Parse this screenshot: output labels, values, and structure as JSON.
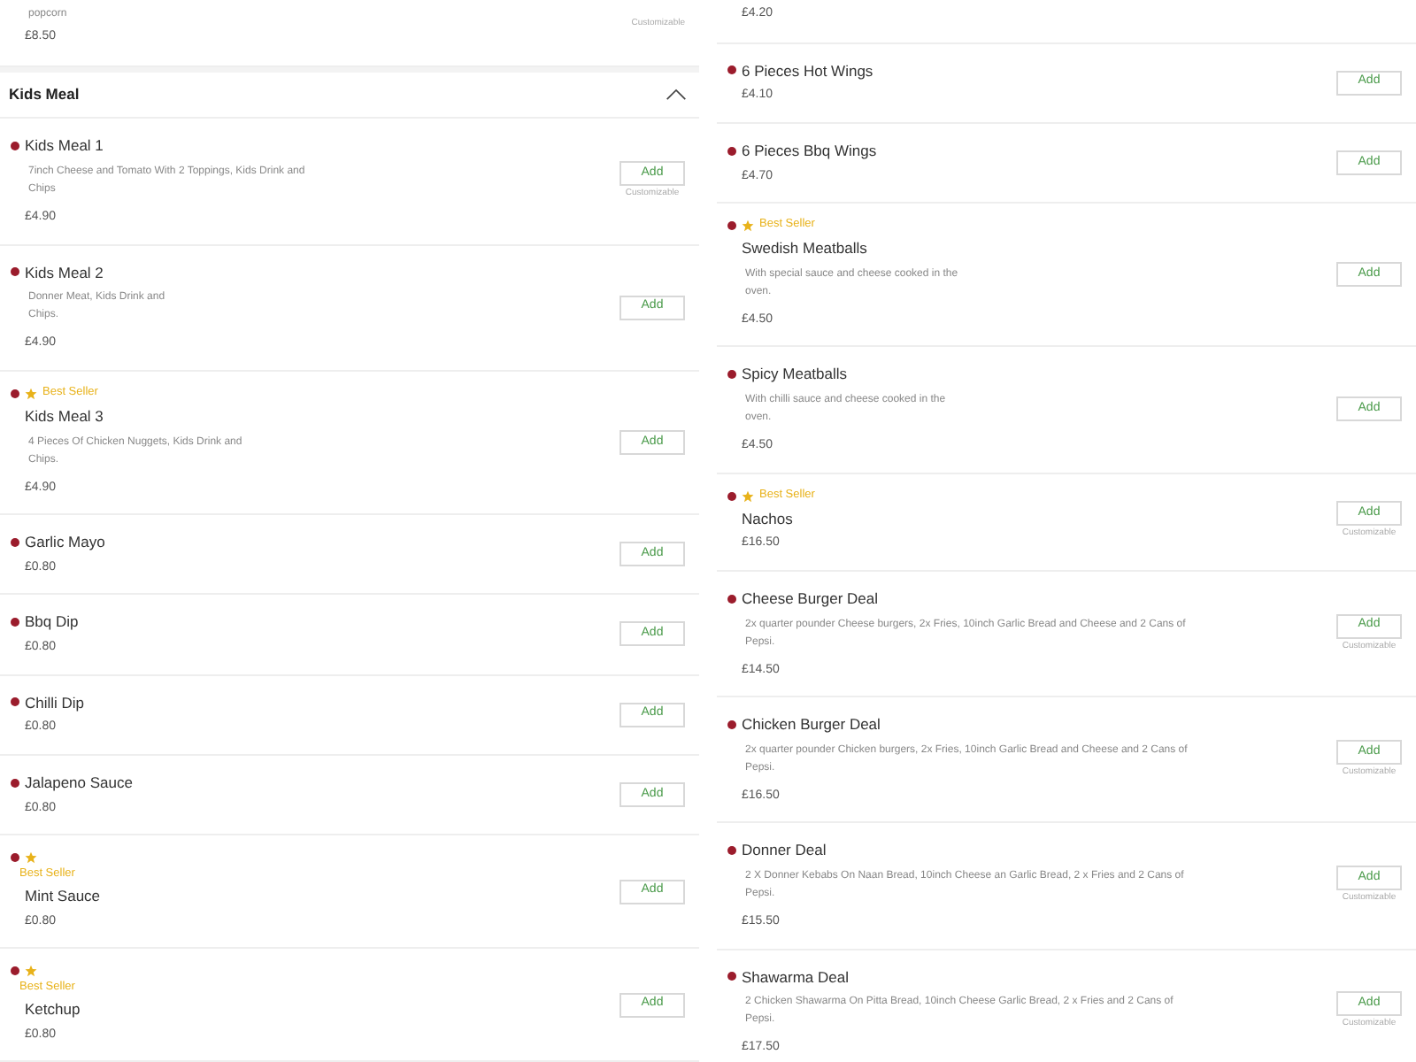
{
  "columns": [
    {
      "blocks": [
        {
          "kind": "item",
          "description_lines": [
            "popcorn"
          ],
          "price": "£8.50",
          "customizable_label": "Customizable"
        },
        {
          "kind": "header",
          "title": "Kids Meal",
          "expanded": true
        },
        {
          "kind": "item",
          "name": "Kids Meal 1",
          "description_lines": [
            "7inch Cheese and Tomato With 2 Toppings, Kids Drink and",
            "Chips"
          ],
          "price": "£4.90",
          "add_label": "Add",
          "customizable_label": "Customizable"
        },
        {
          "kind": "item",
          "name": "Kids Meal 2",
          "description_lines": [
            "Donner Meat, Kids Drink and",
            "Chips."
          ],
          "price": "£4.90",
          "add_label": "Add"
        },
        {
          "kind": "item",
          "name": "Kids Meal 3",
          "description_lines": [
            "4 Pieces Of Chicken Nuggets, Kids Drink and",
            "Chips."
          ],
          "price": "£4.90",
          "add_label": "Add",
          "best_seller": {
            "kind": "inline",
            "label": "Best Seller"
          }
        },
        {
          "kind": "item",
          "name": "Garlic Mayo",
          "price": "£0.80",
          "add_label": "Add"
        },
        {
          "kind": "item",
          "name": "Bbq Dip",
          "price": "£0.80",
          "add_label": "Add"
        },
        {
          "kind": "item",
          "name": "Chilli Dip",
          "price": "£0.80",
          "add_label": "Add"
        },
        {
          "kind": "item",
          "name": "Jalapeno Sauce",
          "price": "£0.80",
          "add_label": "Add"
        },
        {
          "kind": "item",
          "name": "Mint Sauce",
          "price": "£0.80",
          "add_label": "Add",
          "best_seller": {
            "kind": "stacked",
            "label": "Best Seller"
          }
        },
        {
          "kind": "item",
          "name": "Ketchup",
          "price": "£0.80",
          "add_label": "Add",
          "best_seller": {
            "kind": "stacked",
            "label": "Best Seller"
          }
        }
      ]
    },
    {
      "blocks": [
        {
          "kind": "item",
          "price": "£4.20"
        },
        {
          "kind": "item",
          "name": "6 Pieces Hot Wings",
          "price": "£4.10",
          "add_label": "Add"
        },
        {
          "kind": "item",
          "name": "6 Pieces Bbq Wings",
          "price": "£4.70",
          "add_label": "Add"
        },
        {
          "kind": "item",
          "name": "Swedish Meatballs",
          "description_lines": [
            "With special sauce and cheese cooked in the",
            "oven."
          ],
          "price": "£4.50",
          "add_label": "Add",
          "best_seller": {
            "kind": "inline",
            "label": "Best Seller"
          }
        },
        {
          "kind": "item",
          "name": "Spicy Meatballs",
          "description_lines": [
            "With chilli sauce and cheese cooked in the",
            "oven."
          ],
          "price": "£4.50",
          "add_label": "Add"
        },
        {
          "kind": "item",
          "name": "Nachos",
          "price": "£16.50",
          "add_label": "Add",
          "customizable_label": "Customizable",
          "best_seller": {
            "kind": "inline",
            "label": "Best Seller"
          }
        },
        {
          "kind": "item",
          "name": "Cheese Burger Deal",
          "description_lines": [
            "2x quarter pounder Cheese burgers, 2x Fries, 10inch Garlic Bread and Cheese and 2 Cans of",
            "Pepsi."
          ],
          "price": "£14.50",
          "add_label": "Add",
          "customizable_label": "Customizable"
        },
        {
          "kind": "item",
          "name": "Chicken Burger Deal",
          "description_lines": [
            "2x quarter pounder Chicken burgers, 2x Fries, 10inch Garlic Bread and Cheese and 2 Cans of",
            "Pepsi."
          ],
          "price": "£16.50",
          "add_label": "Add",
          "customizable_label": "Customizable"
        },
        {
          "kind": "item",
          "name": "Donner Deal",
          "description_lines": [
            "2 X Donner Kebabs On Naan Bread, 10inch Cheese an Garlic Bread, 2 x Fries and 2 Cans of",
            "Pepsi."
          ],
          "price": "£15.50",
          "add_label": "Add",
          "customizable_label": "Customizable"
        },
        {
          "kind": "item",
          "name": "Shawarma Deal",
          "description_lines": [
            "2 Chicken Shawarma On Pitta Bread, 10inch Cheese Garlic Bread, 2 x Fries and 2 Cans of",
            "Pepsi."
          ],
          "price": "£17.50",
          "add_label": "Add",
          "customizable_label": "Customizable"
        }
      ]
    }
  ]
}
